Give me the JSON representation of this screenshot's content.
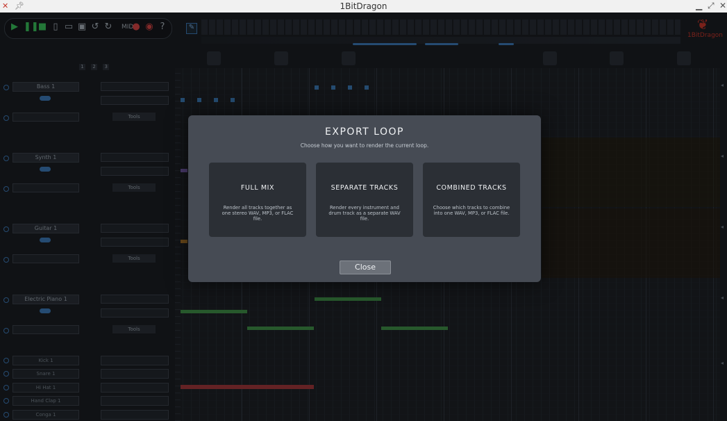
{
  "window": {
    "title": "1BitDragon"
  },
  "toolbar": {
    "midi_label": "MIDI"
  },
  "modal": {
    "title": "EXPORT LOOP",
    "subtitle": "Choose how you want to render the current loop.",
    "options": [
      {
        "title": "FULL MIX",
        "description": "Render all tracks together as one stereo WAV, MP3, or FLAC file."
      },
      {
        "title": "SEPARATE TRACKS",
        "description": "Render every instrument and drum track as a separate WAV file."
      },
      {
        "title": "COMBINED TRACKS",
        "description": "Choose which tracks to combine into one WAV, MP3, or FLAC file."
      }
    ],
    "close_label": "Close"
  },
  "logo": {
    "text": "1BitDragon"
  },
  "page_tabs": [
    "1",
    "2",
    "3"
  ],
  "instruments": [
    {
      "name": "Bass 1",
      "tools": "Tools"
    },
    {
      "name": "Synth 1",
      "tools": "Tools"
    },
    {
      "name": "Guitar 1",
      "tools": "Tools"
    },
    {
      "name": "Electric Piano 1",
      "tools": "Tools"
    }
  ],
  "drums": [
    "Kick 1",
    "Snare 1",
    "Hi Hat 1",
    "Hand Clap 1",
    "Conga 1"
  ],
  "colors": {
    "accent": "#3d7ab8",
    "play": "#39c15b",
    "record": "#d64545",
    "note_green": "#3f8e47",
    "note_red": "#a1373a"
  }
}
